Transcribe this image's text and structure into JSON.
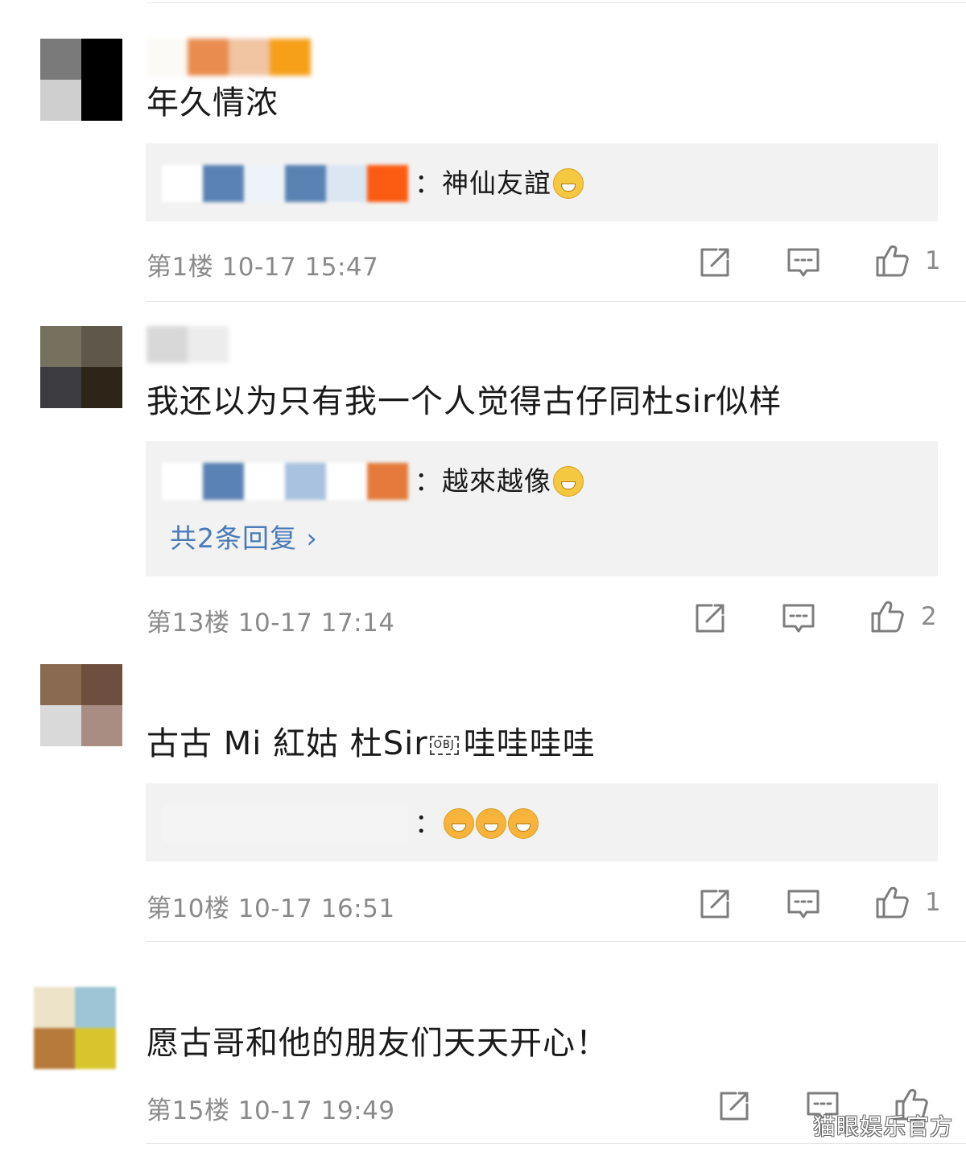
{
  "comments": [
    {
      "text": "年久情浓",
      "reply": {
        "text": "神仙友誼",
        "emoji_count": 1
      },
      "meta": "第1楼 10-17 15:47",
      "likes": "1",
      "avatar_colors": [
        "#7a7a7a",
        "#000000",
        "#cfcfcf",
        "#000000"
      ],
      "username_colors": [
        "#fbfaf6",
        "#e98c4f",
        "#f1c4a2",
        "#f6a01a"
      ],
      "reply_user_colors": [
        "#ffffff",
        "#5a82b3",
        "#eef3f9",
        "#5a82b3",
        "#dbe6f2",
        "#fa5c12"
      ]
    },
    {
      "text": "我还以为只有我一个人觉得古仔同杜sir似样",
      "reply": {
        "text": "越來越像",
        "emoji_count": 1
      },
      "more_replies": "共2条回复 ›",
      "meta": "第13楼 10-17 17:14",
      "likes": "2",
      "avatar_colors": [
        "#76705f",
        "#5f574a",
        "#3b3b40",
        "#2f2418"
      ],
      "username_colors": [
        "#d8d8d8",
        "#ececec"
      ],
      "reply_user_colors": [
        "#ffffff",
        "#5a82b3",
        "#ffffff",
        "#a9c2e0",
        "#ffffff",
        "#e47b3c"
      ]
    },
    {
      "text_before": "古古 Mi 紅姑 杜Sir",
      "obj": "OBJ",
      "text_after": "哇哇哇哇",
      "reply": {
        "text": "",
        "emoji_count": 3
      },
      "meta": "第10楼 10-17 16:51",
      "likes": "1",
      "avatar_colors": [
        "#8b6a52",
        "#6e4f3d",
        "#d9d9d9",
        "#aa8d82"
      ],
      "username_colors": [],
      "reply_user_colors": [
        "#f4f4f4",
        "#f4f4f4",
        "#f4f4f4",
        "#f4f4f4",
        "#f4f4f4",
        "#f4f4f4"
      ]
    },
    {
      "text": "愿古哥和他的朋友们天天开心！",
      "meta": "第15楼 10-17 19:49",
      "likes": "",
      "avatar_colors": [
        "#ede3c9",
        "#9cc4d4",
        "#b87a3a",
        "#d8c52e"
      ],
      "username_colors": []
    }
  ],
  "icons": [
    "share-icon",
    "comment-icon",
    "like-icon"
  ],
  "watermark": "猫眼娱乐官方",
  "colors": {
    "link": "#4a7ab8",
    "meta": "#8a8a8a",
    "reply_bg": "#f2f2f2"
  }
}
